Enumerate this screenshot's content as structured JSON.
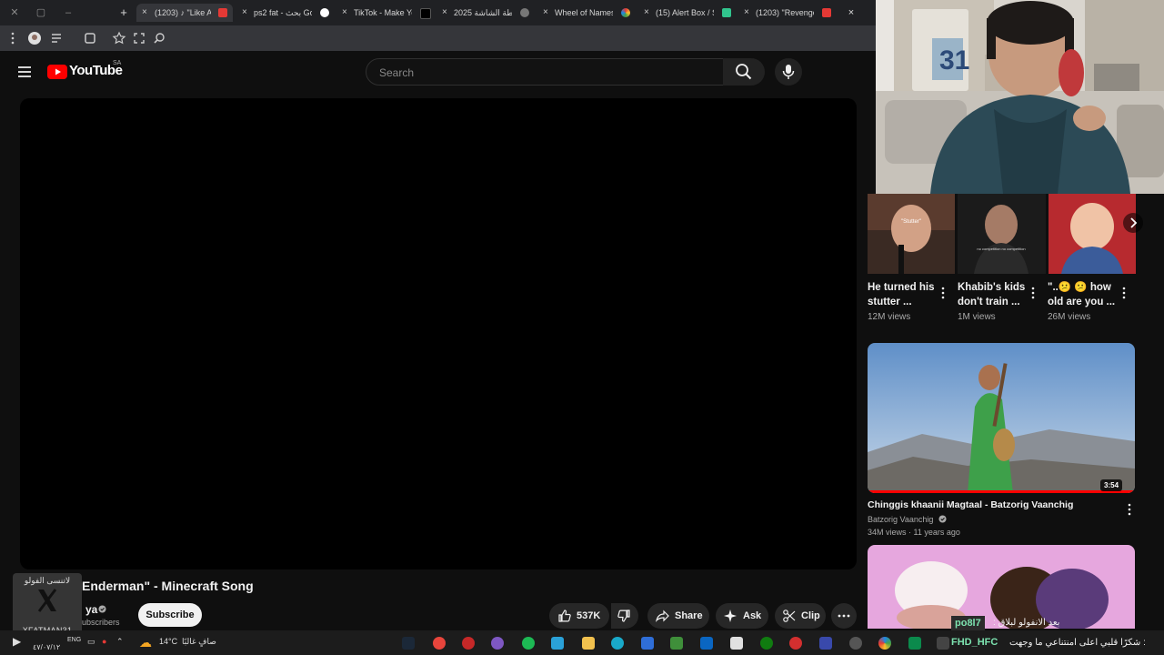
{
  "browser": {
    "tabs": [
      {
        "title": "(1203) ♪ \"Like An",
        "active": true
      },
      {
        "title": "ps2 fat - بحث Goo",
        "active": false
      },
      {
        "title": "TikTok - Make You",
        "active": false
      },
      {
        "title": "لقطة الشاشة 2025",
        "active": false
      },
      {
        "title": "Wheel of Names",
        "active": false
      },
      {
        "title": "(15) Alert Box / St",
        "active": false
      },
      {
        "title": "(1203) \"Revenge\"",
        "active": false
      }
    ],
    "new_tab_symbol": "+",
    "close_symbol": "×",
    "toolbar_icons": [
      "menu-dots-icon",
      "profile-icon",
      "reading-list-icon",
      "extensions-icon",
      "star-icon",
      "screenshot-icon",
      "zoom-icon"
    ]
  },
  "youtube": {
    "logo_text": "YouTube",
    "region": "SA",
    "search": {
      "placeholder": "Search"
    },
    "video": {
      "title": "Enderman\" - Minecraft Song",
      "channel_name": "ya",
      "subscribers": "ubscribers",
      "subscribe_label": "Subscribe",
      "likes": "537K",
      "share_label": "Share",
      "ask_label": "Ask",
      "clip_label": "Clip"
    },
    "shorts": [
      {
        "title": "He turned his stutter ...",
        "views": "12M views",
        "thumb_text": "\"Stutter\""
      },
      {
        "title": "Khabib's kids don't train ...",
        "views": "1M views",
        "thumb_text": "no competition no competition"
      },
      {
        "title": "\"..😕 😕 how old are you ...",
        "views": "26M views"
      }
    ],
    "recommended": [
      {
        "title": "Chinggis khaanii Magtaal - Batzorig Vaanchig",
        "channel": "Batzorig Vaanchig",
        "meta": "34M views · 11 years ago",
        "duration": "3:54"
      }
    ]
  },
  "overlay": {
    "badge_arabic": "لاتنسى الفولو",
    "badge_name": "XFATMAN31",
    "po_tag": "po8l7",
    "follow_text": ": بعد الانفولو لبلاق",
    "fhd_tag": "FHD_HFC",
    "support_text": "شكرًا قلبي اعلى امنتناعي ما وجهت :"
  },
  "webcam": {
    "jersey_number": "31"
  },
  "taskbar": {
    "weather_temp": "14°C",
    "weather_text": "صافٍ غالبًا",
    "date": "٤٧/٠٧/١٢",
    "lang": "ENG",
    "colors": {
      "spotify": "#1db954",
      "chrome": "#e8453c",
      "steam": "#1b2838"
    }
  }
}
